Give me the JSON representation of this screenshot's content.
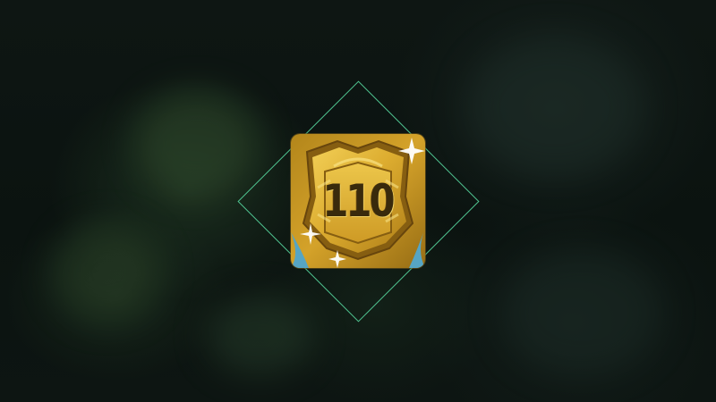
{
  "scene": {
    "accent_color": "#46c98f",
    "badge_gold": "#d9a21c"
  },
  "item": {
    "icon": "gold-level-badge-icon",
    "level": "110"
  }
}
